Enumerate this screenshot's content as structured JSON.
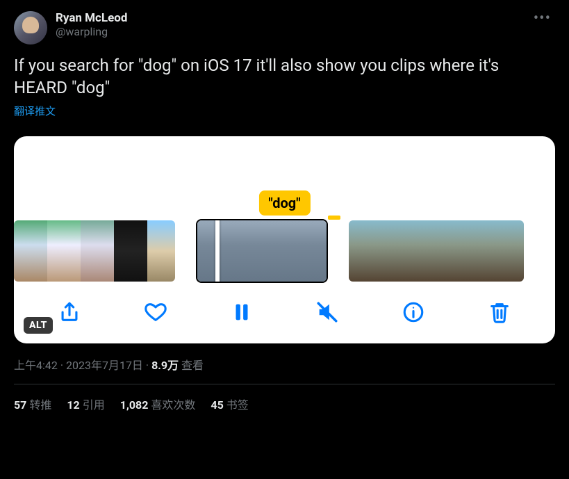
{
  "author": {
    "display_name": "Ryan McLeod",
    "handle": "@warpling"
  },
  "tweet_text": "If you search for \"dog\" on iOS 17 it'll also show you clips where it's HEARD \"dog\"",
  "translate_label": "翻译推文",
  "media": {
    "caption_bubble": "\"dog\"",
    "alt_badge": "ALT",
    "toolbar_icons": [
      "share-icon",
      "heart-icon",
      "pause-icon",
      "mute-icon",
      "info-icon",
      "trash-icon"
    ]
  },
  "meta": {
    "time": "上午4:42",
    "date": "2023年7月17日",
    "views_count": "8.9万",
    "views_label": "查看",
    "separator": " · "
  },
  "stats": {
    "retweets": {
      "count": "57",
      "label": "转推"
    },
    "quotes": {
      "count": "12",
      "label": "引用"
    },
    "likes": {
      "count": "1,082",
      "label": "喜欢次数"
    },
    "bookmarks": {
      "count": "45",
      "label": "书签"
    }
  }
}
